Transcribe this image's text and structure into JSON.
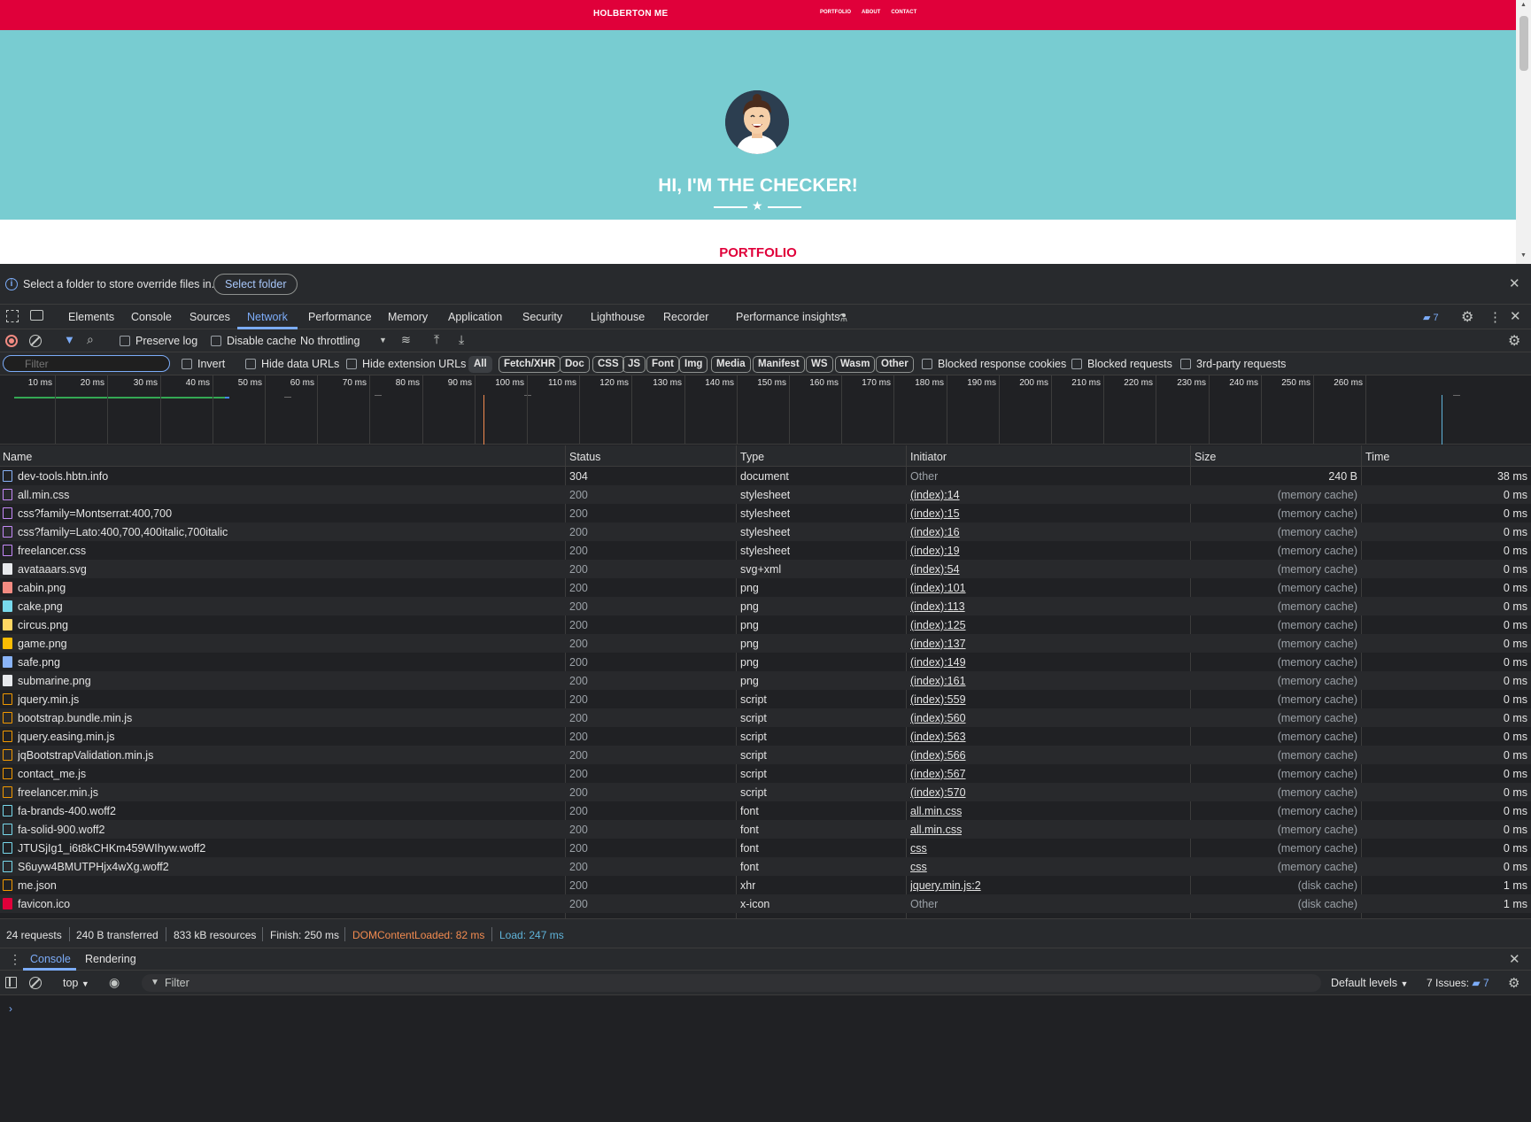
{
  "site": {
    "brand": "HOLBERTON ME",
    "nav": [
      "PORTFOLIO",
      "ABOUT",
      "CONTACT"
    ],
    "hero_title": "HI, I'M THE CHECKER!",
    "section_title": "PORTFOLIO"
  },
  "infobar": {
    "text": "Select a folder to store override files in.",
    "button": "Select folder"
  },
  "tabs": {
    "items": [
      "Elements",
      "Console",
      "Sources",
      "Network",
      "Performance",
      "Memory",
      "Application",
      "Security",
      "Lighthouse",
      "Recorder",
      "Performance insights"
    ],
    "active": "Network",
    "issues_count": "7"
  },
  "toolbar": {
    "preserve_log": "Preserve log",
    "disable_cache": "Disable cache",
    "throttling": "No throttling"
  },
  "filterbar": {
    "placeholder": "Filter",
    "invert": "Invert",
    "hide_data_urls": "Hide data URLs",
    "hide_extension_urls": "Hide extension URLs",
    "types": [
      "All",
      "Fetch/XHR",
      "Doc",
      "CSS",
      "JS",
      "Font",
      "Img",
      "Media",
      "Manifest",
      "WS",
      "Wasm",
      "Other"
    ],
    "active_type": "All",
    "blocked_cookies": "Blocked response cookies",
    "blocked_requests": "Blocked requests",
    "third_party": "3rd-party requests"
  },
  "overview": {
    "ticks": [
      "10 ms",
      "20 ms",
      "30 ms",
      "40 ms",
      "50 ms",
      "60 ms",
      "70 ms",
      "80 ms",
      "90 ms",
      "100 ms",
      "110 ms",
      "120 ms",
      "130 ms",
      "140 ms",
      "150 ms",
      "160 ms",
      "170 ms",
      "180 ms",
      "190 ms",
      "200 ms",
      "210 ms",
      "220 ms",
      "230 ms",
      "240 ms",
      "250 ms",
      "260 ms"
    ]
  },
  "grid": {
    "columns": [
      "Name",
      "Status",
      "Type",
      "Initiator",
      "Size",
      "Time"
    ],
    "rows": [
      {
        "name": "dev-tools.hbtn.info",
        "status": "304",
        "type": "document",
        "initiator": "Other",
        "size": "240 B",
        "time": "38 ms",
        "icon": "document-icon",
        "color": "#8ab4f8"
      },
      {
        "name": "all.min.css",
        "status": "200",
        "type": "stylesheet",
        "initiator": "(index):14",
        "size": "(memory cache)",
        "time": "0 ms",
        "icon": "stylesheet-icon",
        "color": "#c58af9"
      },
      {
        "name": "css?family=Montserrat:400,700",
        "status": "200",
        "type": "stylesheet",
        "initiator": "(index):15",
        "size": "(memory cache)",
        "time": "0 ms",
        "icon": "stylesheet-icon",
        "color": "#c58af9"
      },
      {
        "name": "css?family=Lato:400,700,400italic,700italic",
        "status": "200",
        "type": "stylesheet",
        "initiator": "(index):16",
        "size": "(memory cache)",
        "time": "0 ms",
        "icon": "stylesheet-icon",
        "color": "#c58af9"
      },
      {
        "name": "freelancer.css",
        "status": "200",
        "type": "stylesheet",
        "initiator": "(index):19",
        "size": "(memory cache)",
        "time": "0 ms",
        "icon": "stylesheet-icon",
        "color": "#c58af9"
      },
      {
        "name": "avataaars.svg",
        "status": "200",
        "type": "svg+xml",
        "initiator": "(index):54",
        "size": "(memory cache)",
        "time": "0 ms",
        "icon": "image-icon",
        "color": "#e8eaed"
      },
      {
        "name": "cabin.png",
        "status": "200",
        "type": "png",
        "initiator": "(index):101",
        "size": "(memory cache)",
        "time": "0 ms",
        "icon": "image-icon",
        "color": "#f28b82"
      },
      {
        "name": "cake.png",
        "status": "200",
        "type": "png",
        "initiator": "(index):113",
        "size": "(memory cache)",
        "time": "0 ms",
        "icon": "image-icon",
        "color": "#78d9ec"
      },
      {
        "name": "circus.png",
        "status": "200",
        "type": "png",
        "initiator": "(index):125",
        "size": "(memory cache)",
        "time": "0 ms",
        "icon": "image-icon",
        "color": "#fdd663"
      },
      {
        "name": "game.png",
        "status": "200",
        "type": "png",
        "initiator": "(index):137",
        "size": "(memory cache)",
        "time": "0 ms",
        "icon": "image-icon",
        "color": "#fbbc04"
      },
      {
        "name": "safe.png",
        "status": "200",
        "type": "png",
        "initiator": "(index):149",
        "size": "(memory cache)",
        "time": "0 ms",
        "icon": "image-icon",
        "color": "#8ab4f8"
      },
      {
        "name": "submarine.png",
        "status": "200",
        "type": "png",
        "initiator": "(index):161",
        "size": "(memory cache)",
        "time": "0 ms",
        "icon": "image-icon",
        "color": "#e8eaed"
      },
      {
        "name": "jquery.min.js",
        "status": "200",
        "type": "script",
        "initiator": "(index):559",
        "size": "(memory cache)",
        "time": "0 ms",
        "icon": "script-icon",
        "color": "#f29900"
      },
      {
        "name": "bootstrap.bundle.min.js",
        "status": "200",
        "type": "script",
        "initiator": "(index):560",
        "size": "(memory cache)",
        "time": "0 ms",
        "icon": "script-icon",
        "color": "#f29900"
      },
      {
        "name": "jquery.easing.min.js",
        "status": "200",
        "type": "script",
        "initiator": "(index):563",
        "size": "(memory cache)",
        "time": "0 ms",
        "icon": "script-icon",
        "color": "#f29900"
      },
      {
        "name": "jqBootstrapValidation.min.js",
        "status": "200",
        "type": "script",
        "initiator": "(index):566",
        "size": "(memory cache)",
        "time": "0 ms",
        "icon": "script-icon",
        "color": "#f29900"
      },
      {
        "name": "contact_me.js",
        "status": "200",
        "type": "script",
        "initiator": "(index):567",
        "size": "(memory cache)",
        "time": "0 ms",
        "icon": "script-icon",
        "color": "#f29900"
      },
      {
        "name": "freelancer.min.js",
        "status": "200",
        "type": "script",
        "initiator": "(index):570",
        "size": "(memory cache)",
        "time": "0 ms",
        "icon": "script-icon",
        "color": "#f29900"
      },
      {
        "name": "fa-brands-400.woff2",
        "status": "200",
        "type": "font",
        "initiator": "all.min.css",
        "size": "(memory cache)",
        "time": "0 ms",
        "icon": "font-icon",
        "color": "#78d9ec"
      },
      {
        "name": "fa-solid-900.woff2",
        "status": "200",
        "type": "font",
        "initiator": "all.min.css",
        "size": "(memory cache)",
        "time": "0 ms",
        "icon": "font-icon",
        "color": "#78d9ec"
      },
      {
        "name": "JTUSjIg1_i6t8kCHKm459WIhyw.woff2",
        "status": "200",
        "type": "font",
        "initiator": "css",
        "size": "(memory cache)",
        "time": "0 ms",
        "icon": "font-icon",
        "color": "#78d9ec"
      },
      {
        "name": "S6uyw4BMUTPHjx4wXg.woff2",
        "status": "200",
        "type": "font",
        "initiator": "css",
        "size": "(memory cache)",
        "time": "0 ms",
        "icon": "font-icon",
        "color": "#78d9ec"
      },
      {
        "name": "me.json",
        "status": "200",
        "type": "xhr",
        "initiator": "jquery.min.js:2",
        "size": "(disk cache)",
        "time": "1 ms",
        "icon": "xhr-icon",
        "color": "#f29900"
      },
      {
        "name": "favicon.ico",
        "status": "200",
        "type": "x-icon",
        "initiator": "Other",
        "size": "(disk cache)",
        "time": "1 ms",
        "icon": "favicon-icon",
        "color": "#e0003a"
      }
    ]
  },
  "summary": {
    "requests": "24 requests",
    "transferred": "240 B transferred",
    "resources": "833 kB resources",
    "finish": "Finish: 250 ms",
    "dcl": "DOMContentLoaded: 82 ms",
    "load": "Load: 247 ms"
  },
  "drawer": {
    "tabs": [
      "Console",
      "Rendering"
    ],
    "active": "Console",
    "context": "top",
    "filter_placeholder": "Filter",
    "levels": "Default levels",
    "issues_label": "7 Issues:",
    "issues_count": "7"
  },
  "colors": {
    "brand_red": "#e0003a",
    "masthead": "#78ccd1",
    "accent_blue": "#7cacf8",
    "dcl_orange": "#f28b50",
    "load_blue": "#5fb3d9"
  }
}
